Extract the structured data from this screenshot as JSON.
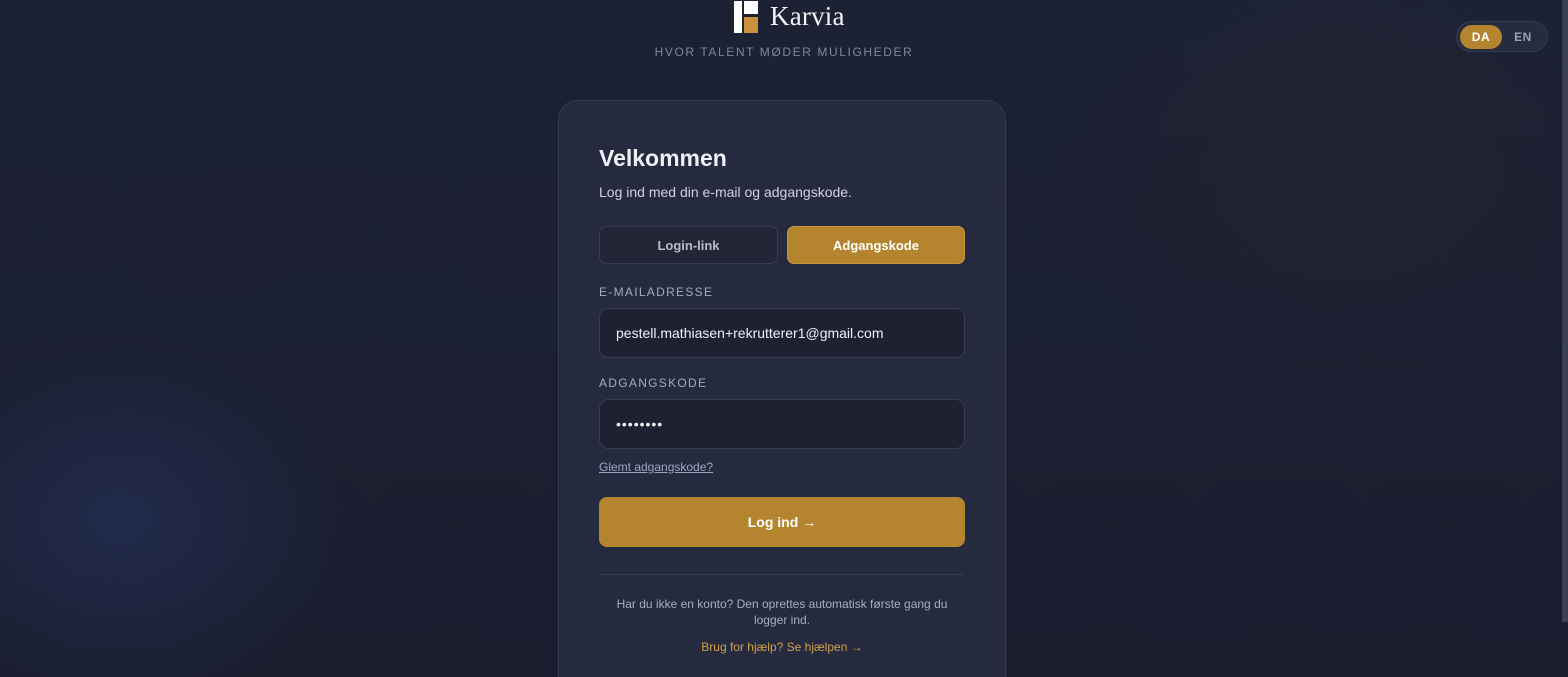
{
  "brand": {
    "name": "Karvia",
    "tagline": "HVOR TALENT MØDER MULIGHEDER"
  },
  "language": {
    "options": [
      "DA",
      "EN"
    ],
    "selected": "DA"
  },
  "login": {
    "title": "Velkommen",
    "subtitle": "Log ind med din e-mail og adgangskode.",
    "tabs": [
      {
        "label": "Login-link",
        "active": false
      },
      {
        "label": "Adgangskode",
        "active": true
      }
    ],
    "email": {
      "label": "E-MAILADRESSE",
      "value": "pestell.mathiasen+rekrutterer1@gmail.com"
    },
    "password": {
      "label": "ADGANGSKODE",
      "value": "••••••••"
    },
    "forgot_label": "Glemt adgangskode?",
    "submit_label": "Log ind",
    "submit_arrow": "→",
    "no_account_text": "Har du ikke en konto? Den oprettes automatisk første gang du logger ind.",
    "help_link": "Brug for hjælp? Se hjælpen →"
  },
  "colors": {
    "accent": "#b4842e",
    "background": "#1c2134",
    "card": "#262a3e"
  }
}
